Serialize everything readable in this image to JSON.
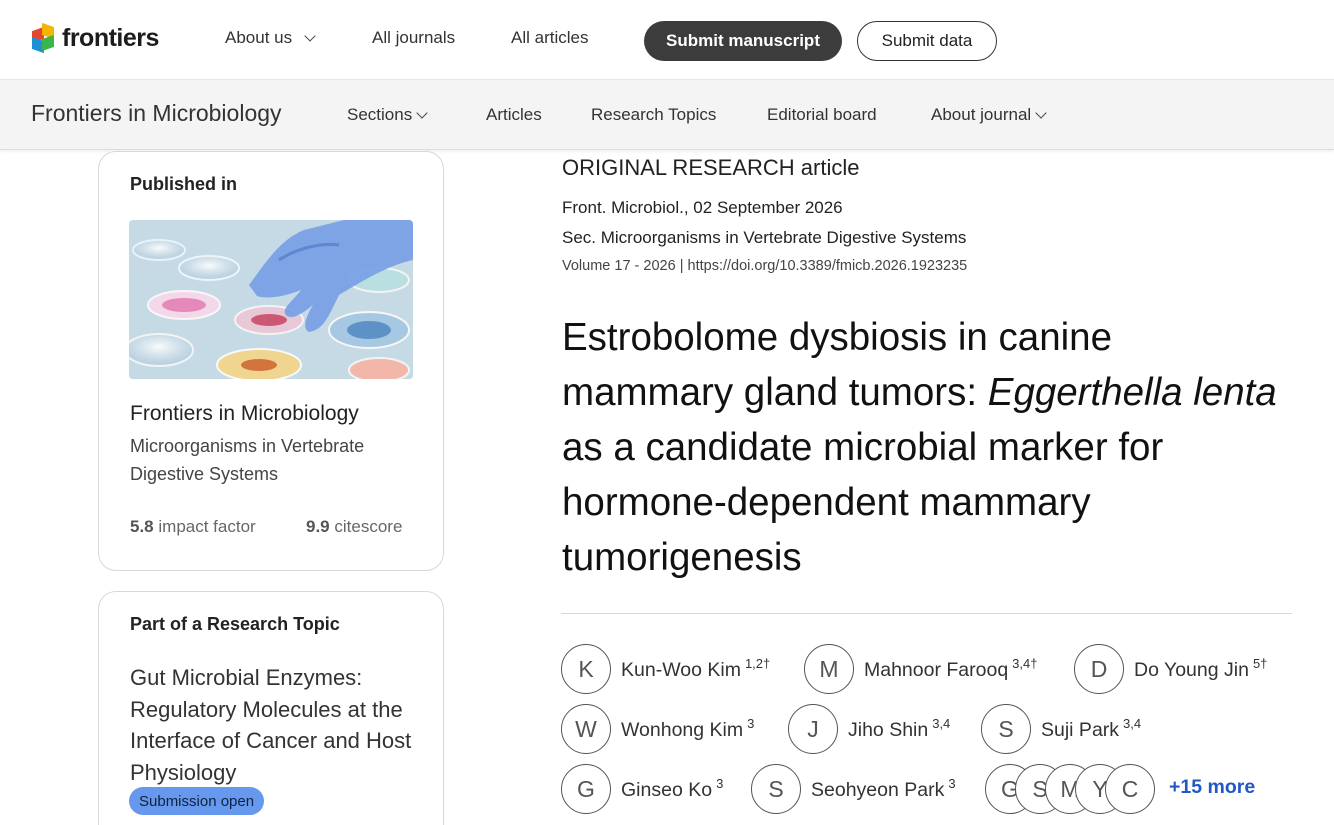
{
  "topbar": {
    "brand": "frontiers",
    "nav": [
      {
        "label": "About us",
        "has_dropdown": true
      },
      {
        "label": "All journals",
        "has_dropdown": false
      },
      {
        "label": "All articles",
        "has_dropdown": false
      }
    ],
    "submit_manuscript": "Submit manuscript",
    "submit_data": "Submit data"
  },
  "journalbar": {
    "title": "Frontiers in Microbiology",
    "nav": [
      {
        "label": "Sections",
        "has_dropdown": true
      },
      {
        "label": "Articles",
        "has_dropdown": false
      },
      {
        "label": "Research Topics",
        "has_dropdown": false
      },
      {
        "label": "Editorial board",
        "has_dropdown": false
      },
      {
        "label": "About journal",
        "has_dropdown": true
      }
    ]
  },
  "published_in": {
    "heading": "Published in",
    "journal": "Frontiers in Microbiology",
    "section": "Microorganisms in Vertebrate Digestive Systems",
    "impact_factor_value": "5.8",
    "impact_factor_label": "impact factor",
    "citescore_value": "9.9",
    "citescore_label": "citescore"
  },
  "research_topic": {
    "heading": "Part of a Research Topic",
    "title": "Gut Microbial Enzymes: Regulatory Molecules at the Interface of Cancer and Host Physiology",
    "badge": "Submission open"
  },
  "article": {
    "type": "ORIGINAL RESEARCH article",
    "journal_date": "Front. Microbiol., 02 September 2026",
    "section": "Sec. Microorganisms in Vertebrate Digestive Systems",
    "volume": "Volume 17 - 2026",
    "separator": "|",
    "doi": "https://doi.org/10.3389/fmicb.2026.1923235",
    "title_part1": "Estrobolome dysbiosis in canine mammary gland tumors: ",
    "title_italic": "Eggerthella lenta",
    "title_part2": " as a candidate microbial marker for hormone-dependent mammary tumorigenesis"
  },
  "authors": [
    {
      "initial": "K",
      "name": "Kun-Woo Kim",
      "affil": "1,2†"
    },
    {
      "initial": "M",
      "name": "Mahnoor Farooq",
      "affil": "3,4†"
    },
    {
      "initial": "D",
      "name": "Do Young Jin",
      "affil": "5†"
    },
    {
      "initial": "W",
      "name": "Wonhong Kim",
      "affil": "3"
    },
    {
      "initial": "J",
      "name": "Jiho Shin",
      "affil": "3,4"
    },
    {
      "initial": "S",
      "name": "Suji Park",
      "affil": "3,4"
    },
    {
      "initial": "G",
      "name": "Ginseo Ko",
      "affil": "3"
    },
    {
      "initial": "S",
      "name": "Seohyeon Park",
      "affil": "3"
    }
  ],
  "author_stack": [
    "G",
    "S",
    "M",
    "Y",
    "C"
  ],
  "more_authors": "+15 more",
  "colors": {
    "primary_button": "#3c3c3c",
    "link": "#2257c4",
    "badge": "#6699ee"
  }
}
